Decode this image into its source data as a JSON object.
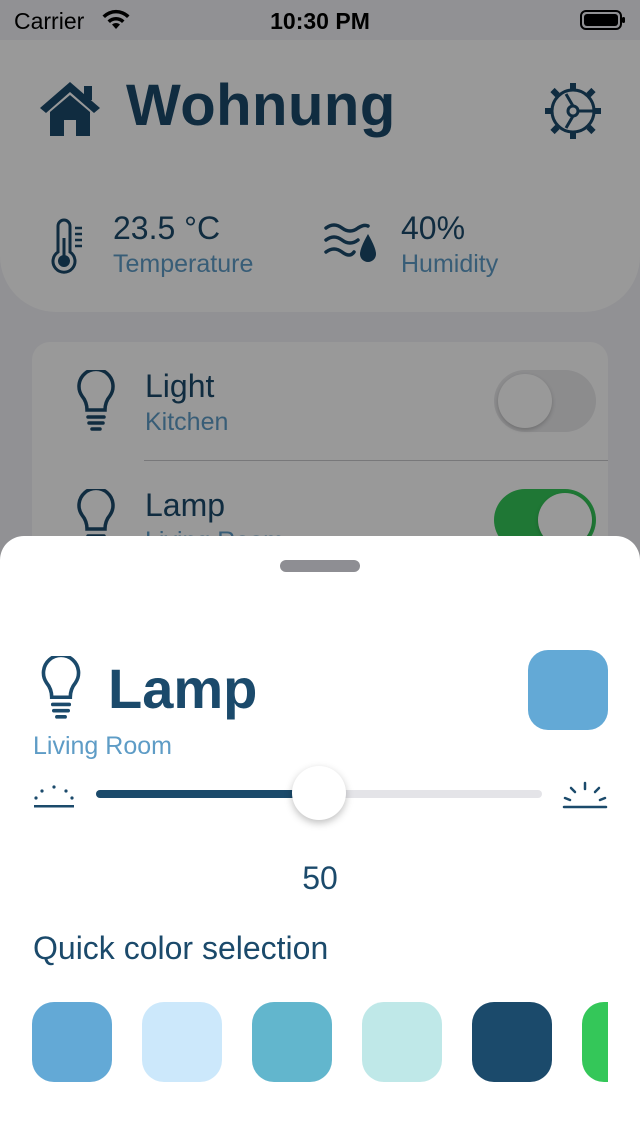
{
  "status_bar": {
    "carrier": "Carrier",
    "time": "10:30 PM"
  },
  "header": {
    "title": "Wohnung",
    "home_icon": "home-icon",
    "settings_icon": "gear-icon"
  },
  "sensors": [
    {
      "value": "23.5 °C",
      "label": "Temperature",
      "icon": "thermometer-icon"
    },
    {
      "value": "40%",
      "label": "Humidity",
      "icon": "humidity-icon"
    }
  ],
  "devices": [
    {
      "name": "Light",
      "room": "Kitchen",
      "on": false,
      "icon": "lightbulb-icon"
    },
    {
      "name": "Lamp",
      "room": "Living Room",
      "on": true,
      "icon": "lightbulb-icon"
    }
  ],
  "sheet": {
    "title": "Lamp",
    "room": "Living Room",
    "current_color": "#63a9d6",
    "brightness": {
      "value": 50,
      "min": 0,
      "max": 100,
      "value_label": "50"
    },
    "quick_title": "Quick color selection",
    "quick_colors": [
      "#63a9d6",
      "#cce8fb",
      "#62b6cd",
      "#bfe8e8",
      "#1b4a6b",
      "#34c759"
    ]
  },
  "colors": {
    "primary": "#1b4a6b",
    "secondary": "#5e9cc6",
    "toggle_on": "#34c759",
    "toggle_off": "#e9e9eb"
  }
}
